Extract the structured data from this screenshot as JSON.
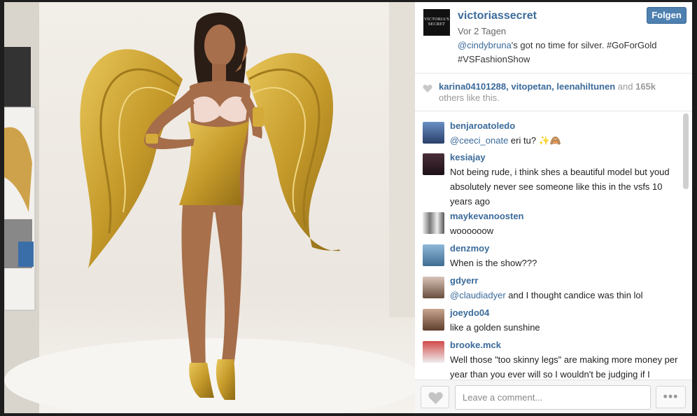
{
  "post": {
    "username": "victoriassecret",
    "logo_text": "VICTORIA'S SECRET",
    "time": "Vor 2 Tagen",
    "caption_mention": "@cindybruna",
    "caption_text": "'s got no time for silver. #GoForGold #VSFashionShow",
    "follow_label": "Folgen"
  },
  "likes": {
    "users": "karina04101288, vitopetan, leenahiltunen",
    "and": " and ",
    "count": "165k",
    "suffix": " others like this."
  },
  "comments": [
    {
      "user": "benjaroatoledo",
      "mention": "@ceeci_onate",
      "text": " eri tu? ✨🙈"
    },
    {
      "user": "kesiajay",
      "mention": "",
      "text": "Not being rude, i think shes a beautiful model but youd absolutely never see someone like this in the vsfs 10 years ago"
    },
    {
      "user": "maykevanoosten",
      "mention": "",
      "text": "woooooow"
    },
    {
      "user": "denzmoy",
      "mention": "",
      "text": "When is the show???"
    },
    {
      "user": "gdyerr",
      "mention": "@claudiadyer",
      "text": " and I thought candice was thin lol"
    },
    {
      "user": "joeydo04",
      "mention": "",
      "text": "like a golden sunshine"
    },
    {
      "user": "brooke.mck",
      "mention": "",
      "text": "Well those \"too skinny legs\" are making more money per year than you ever will so I wouldn't be judging if I"
    }
  ],
  "footer": {
    "comment_placeholder": "Leave a comment...",
    "more_label": "•••"
  },
  "colors": {
    "link": "#3b6b9a",
    "follow_bg": "#4e80b0",
    "gold": "#c9a227"
  }
}
